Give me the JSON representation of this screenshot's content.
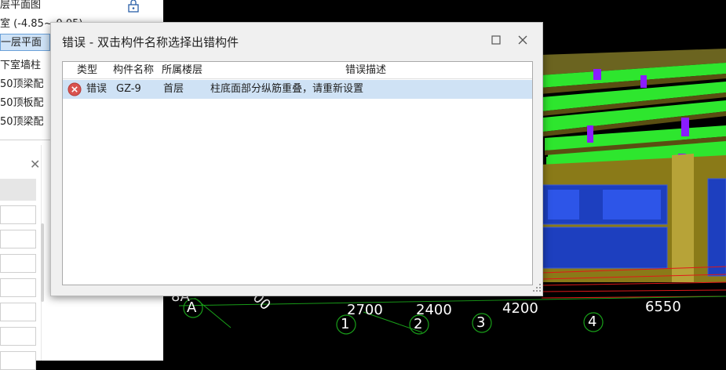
{
  "tree": {
    "items": [
      {
        "label": "层平面图",
        "selected": false
      },
      {
        "label": "室 (-4.85~-0.05)",
        "selected": false
      },
      {
        "label": "一层平面",
        "selected": true
      },
      {
        "label": "下室墙柱",
        "selected": false
      },
      {
        "label": "50顶梁配",
        "selected": false
      },
      {
        "label": "50顶板配",
        "selected": false
      },
      {
        "label": "50顶梁配",
        "selected": false
      }
    ]
  },
  "viewport": {
    "axis_labels": [
      "2700",
      "2400",
      "4200",
      "6550",
      "8A",
      "000"
    ],
    "grid_numbers": [
      "1",
      "2",
      "3",
      "4"
    ],
    "grid_letter": "A",
    "colors": {
      "beam": "#2ee62e",
      "column": "#8a1cff",
      "wall": "#1d3fbf",
      "slab": "#7a6a20",
      "grid": "#e01818"
    }
  },
  "dialog": {
    "title": "错误 - 双击构件名称选择出错构件",
    "columns": [
      "类型",
      "构件名称",
      "所属楼层",
      "错误描述"
    ],
    "rows": [
      {
        "type": "错误",
        "name": "GZ-9",
        "floor": "首层",
        "description": "柱底面部分纵筋重叠，请重新设置",
        "icon": "error-icon"
      }
    ]
  }
}
